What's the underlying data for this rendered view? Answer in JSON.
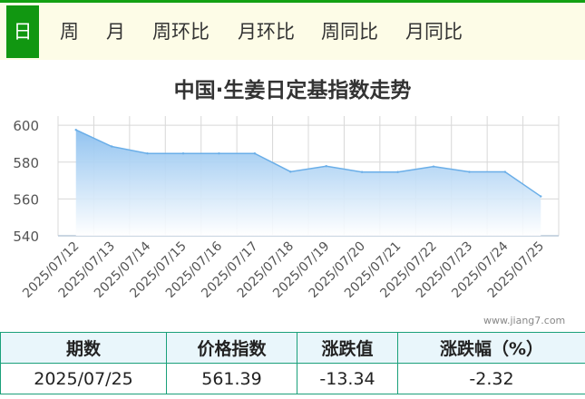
{
  "tabs": [
    {
      "label": "日",
      "active": true
    },
    {
      "label": "周",
      "active": false
    },
    {
      "label": "月",
      "active": false
    },
    {
      "label": "周环比",
      "active": false
    },
    {
      "label": "月环比",
      "active": false
    },
    {
      "label": "周同比",
      "active": false
    },
    {
      "label": "月同比",
      "active": false
    }
  ],
  "chart_data": {
    "type": "area",
    "title": "中国·生姜日定基指数走势",
    "xlabel": "",
    "ylabel": "",
    "x": [
      "2025/07/12",
      "2025/07/13",
      "2025/07/14",
      "2025/07/15",
      "2025/07/16",
      "2025/07/17",
      "2025/07/18",
      "2025/07/19",
      "2025/07/20",
      "2025/07/21",
      "2025/07/22",
      "2025/07/23",
      "2025/07/24",
      "2025/07/25"
    ],
    "series": [
      {
        "values": [
          597.5,
          588.5,
          584.7,
          584.7,
          584.7,
          584.7,
          574.8,
          577.8,
          574.6,
          574.6,
          577.6,
          574.7,
          574.7,
          561.39
        ]
      }
    ],
    "ylim": [
      540,
      605
    ],
    "yticks": [
      540,
      560,
      580,
      600
    ],
    "grid": true,
    "colors": {
      "line": "#6aaee8",
      "fill_top": "#8cc0ef",
      "fill_bottom": "#ffffff",
      "grid": "#d8d8d8"
    }
  },
  "watermark": "www.jiang7.com",
  "summary": {
    "headers": [
      "期数",
      "价格指数",
      "涨跌值",
      "涨跌幅（%）"
    ],
    "row": [
      "2025/07/25",
      "561.39",
      "-13.34",
      "-2.32"
    ]
  }
}
